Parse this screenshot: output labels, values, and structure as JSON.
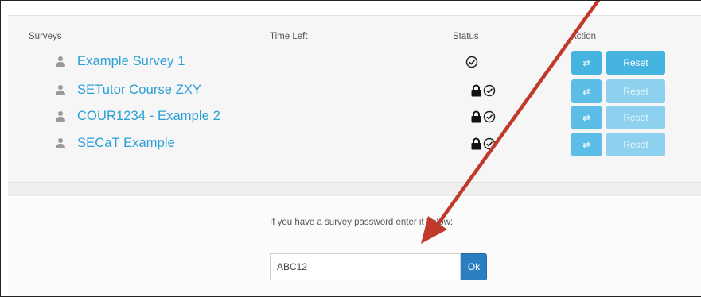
{
  "table": {
    "headers": {
      "surveys": "Surveys",
      "time_left": "Time Left",
      "status": "Status",
      "action": "Action"
    },
    "rows": [
      {
        "name": "Example Survey 1",
        "time_left": "",
        "locked": false,
        "complete": true,
        "swap_label": "⇄",
        "reset_label": "Reset",
        "enabled": true
      },
      {
        "name": "SETutor Course ZXY",
        "time_left": "",
        "locked": true,
        "complete": true,
        "swap_label": "⇄",
        "reset_label": "Reset",
        "enabled": false
      },
      {
        "name": "COUR1234 - Example 2",
        "time_left": "",
        "locked": true,
        "complete": true,
        "swap_label": "⇄",
        "reset_label": "Reset",
        "enabled": false
      },
      {
        "name": "SECaT Example",
        "time_left": "",
        "locked": true,
        "complete": true,
        "swap_label": "⇄",
        "reset_label": "Reset",
        "enabled": false
      }
    ]
  },
  "password_form": {
    "label": "If you have a survey password enter it below:",
    "value": "ABC12",
    "button_label": "Ok"
  },
  "colors": {
    "link": "#2a9fd6",
    "button_primary": "#45b4e1",
    "button_ok": "#2a7fc0",
    "annotation_arrow": "#c0392b"
  },
  "icons": {
    "user": "user-icon",
    "lock": "lock-icon",
    "check": "check-circle-icon",
    "swap": "swap-icon"
  }
}
